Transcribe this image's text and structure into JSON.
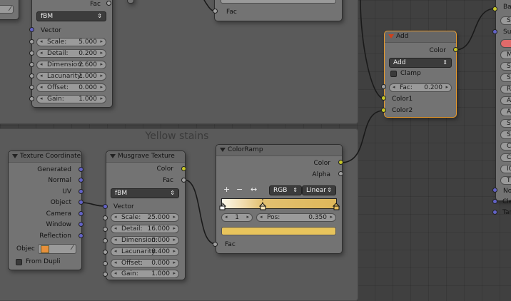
{
  "frames": {
    "top_left_title": "",
    "yellow_stains_title": "Yellow stains"
  },
  "top_musgrave": {
    "fac_label": "Fac",
    "type_value": "fBM",
    "vector_label": "Vector",
    "fields": [
      {
        "key": "Scale:",
        "value": "5.000"
      },
      {
        "key": "Detail:",
        "value": "0.200"
      },
      {
        "key": "Dimension:",
        "value": "2.600"
      },
      {
        "key": "Lacunarity:",
        "value": "1.000"
      },
      {
        "key": "Offset:",
        "value": "0.000"
      },
      {
        "key": "Gain:",
        "value": "1.000"
      }
    ]
  },
  "top_middle_node": {
    "fac_label": "Fac"
  },
  "add_node": {
    "title": "Add",
    "color_out": "Color",
    "blend_value": "Add",
    "clamp_label": "Clamp",
    "fac_key": "Fac:",
    "fac_value": "0.200",
    "color1": "Color1",
    "color2": "Color2"
  },
  "texcoord": {
    "title": "Texture Coordinate",
    "outputs": [
      "Generated",
      "Normal",
      "UV",
      "Object",
      "Camera",
      "Window",
      "Reflection"
    ],
    "object_label": "Objec",
    "from_dupli": "From Dupli"
  },
  "musgrave": {
    "title": "Musgrave Texture",
    "color_out": "Color",
    "fac_out": "Fac",
    "type_value": "fBM",
    "vector_label": "Vector",
    "fields": [
      {
        "key": "Scale:",
        "value": "25.000"
      },
      {
        "key": "Detail:",
        "value": "16.000"
      },
      {
        "key": "Dimension:",
        "value": "0.000"
      },
      {
        "key": "Lacunarity:",
        "value": "8.400"
      },
      {
        "key": "Offset:",
        "value": "0.000"
      },
      {
        "key": "Gain:",
        "value": "1.000"
      }
    ]
  },
  "colorramp": {
    "title": "ColorRamp",
    "color_out": "Color",
    "alpha_out": "Alpha",
    "add_btn": "+",
    "remove_btn": "−",
    "flip_btn": "↔",
    "mode_value": "RGB",
    "interp_value": "Linear",
    "index_value": "1",
    "pos_key": "Pos:",
    "pos_value": "0.350",
    "fac_in": "Fac"
  },
  "right_node": {
    "rows": [
      "Ba",
      "S",
      "Su",
      "",
      "M",
      "S",
      "S",
      "R",
      "A",
      "A",
      "S",
      "S",
      "C",
      "C",
      "IC",
      "T",
      "No",
      "Cle",
      "Tan"
    ]
  },
  "colors": {
    "accent_active": "#e89a2c",
    "socket_color": "#c7c729",
    "socket_vector": "#6363c7",
    "socket_value": "#a1a1a1",
    "swatch": "#e8c45c",
    "red_swatch": "#e06a6a"
  }
}
